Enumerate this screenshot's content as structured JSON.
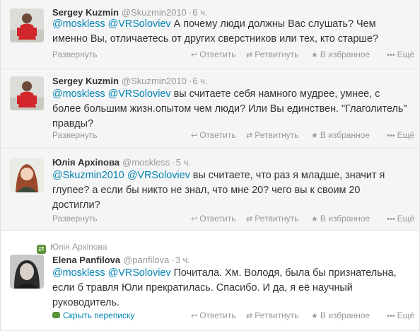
{
  "actions": {
    "expand": "Развернуть",
    "reply": "Ответить",
    "retweet": "Ретвитнуть",
    "favorite": "В избранное",
    "more": "Ещё",
    "hide_conversation": "Скрыть переписку"
  },
  "tweets": [
    {
      "name": "Sergey Kuzmin",
      "handle": "@Skuzmin2010",
      "time": "6 ч.",
      "mentions": "@moskless",
      "body": " А почему люди должны Вас слушать? Чем именно Вы, отличаетесь от других сверстников или тех, кто старше?"
    },
    {
      "name": "Sergey Kuzmin",
      "handle": "@Skuzmin2010",
      "time": "6 ч.",
      "mention1": "@moskless",
      "mention2": "@VRSoloviev",
      "body": " вы считаете себя намного мудрее, умнее, с более большим жизн.опытом чем люди? Или Вы единствен. \"Глаголитель\" правды?"
    },
    {
      "name": "Юлія Архіпова",
      "handle": "@moskless",
      "time": "5 ч.",
      "mention1": "@Skuzmin2010",
      "mention2": "@VRSoloviev",
      "body": " вы считаете, что раз я младше, значит я глупее? а если бы никто не знал, что мне 20? чего вы к своим 20 достигли?"
    },
    {
      "retweeted_by": "Юлія Архіпова",
      "name": "Elena Panfilova",
      "handle": "@panfilova",
      "time": "3 ч.",
      "mention1": "@moskless",
      "mention2": "@VRSoloviev",
      "body": "  Почитала. Хм. Володя, была бы признательна, если б травля Юли прекратилась. Спасибо. И да, я её научный руководитель."
    }
  ],
  "first_extra_mention": "@VRSoloviev",
  "colors": {
    "link": "#0084b4",
    "muted": "#999999",
    "text": "#333333",
    "grey_row": "#f5f5f5"
  }
}
